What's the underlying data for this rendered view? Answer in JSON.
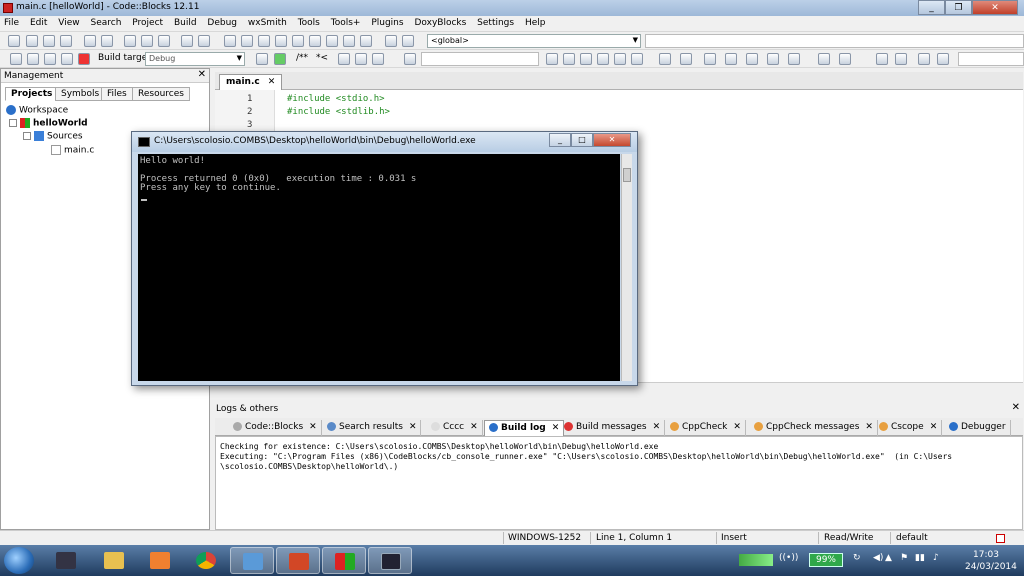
{
  "window": {
    "title": "main.c [helloWorld] - Code::Blocks 12.11"
  },
  "menu": [
    "File",
    "Edit",
    "View",
    "Search",
    "Project",
    "Build",
    "Debug",
    "wxSmith",
    "Tools",
    "Tools+",
    "Plugins",
    "DoxyBlocks",
    "Settings",
    "Help"
  ],
  "toolbar": {
    "scope_combo": "<global>",
    "build_target_label": "Build target:",
    "build_target_value": "Debug",
    "comment_button": "/**",
    "comment_button2": "*<"
  },
  "management": {
    "title": "Management",
    "tabs": [
      "Projects",
      "Symbols",
      "Files",
      "Resources"
    ],
    "tree": {
      "workspace": "Workspace",
      "project": "helloWorld",
      "folder": "Sources",
      "file": "main.c"
    }
  },
  "editor": {
    "tab": "main.c",
    "lines": [
      {
        "n": "1",
        "code": "#include <stdio.h>"
      },
      {
        "n": "2",
        "code": "#include <stdlib.h>"
      },
      {
        "n": "3",
        "code": ""
      }
    ]
  },
  "console": {
    "title": "C:\\Users\\scolosio.COMBS\\Desktop\\helloWorld\\bin\\Debug\\helloWorld.exe",
    "lines": [
      "Hello world!",
      "",
      "Process returned 0 (0x0)   execution time : 0.031 s",
      "Press any key to continue."
    ]
  },
  "logs": {
    "title": "Logs & others",
    "tabs": [
      "Code::Blocks",
      "Search results",
      "Cccc",
      "Build log",
      "Build messages",
      "CppCheck",
      "CppCheck messages",
      "Cscope",
      "Debugger"
    ],
    "active_tab": "Build log",
    "lines": [
      "Checking for existence: C:\\Users\\scolosio.COMBS\\Desktop\\helloWorld\\bin\\Debug\\helloWorld.exe",
      "Executing: \"C:\\Program Files (x86)\\CodeBlocks/cb_console_runner.exe\" \"C:\\Users\\scolosio.COMBS\\Desktop\\helloWorld\\bin\\Debug\\helloWorld.exe\"  (in C:\\Users",
      "\\scolosio.COMBS\\Desktop\\helloWorld\\.)"
    ]
  },
  "status": {
    "encoding": "WINDOWS-1252",
    "position": "Line 1, Column 1",
    "mode": "Insert",
    "access": "Read/Write",
    "profile": "default"
  },
  "taskbar": {
    "battery": "99%",
    "time": "17:03",
    "date": "24/03/2014"
  },
  "colors": {
    "code_green": "#228b22",
    "console_bg": "#000000",
    "console_text": "#c0c0c0",
    "battery": "#2fa84a"
  }
}
